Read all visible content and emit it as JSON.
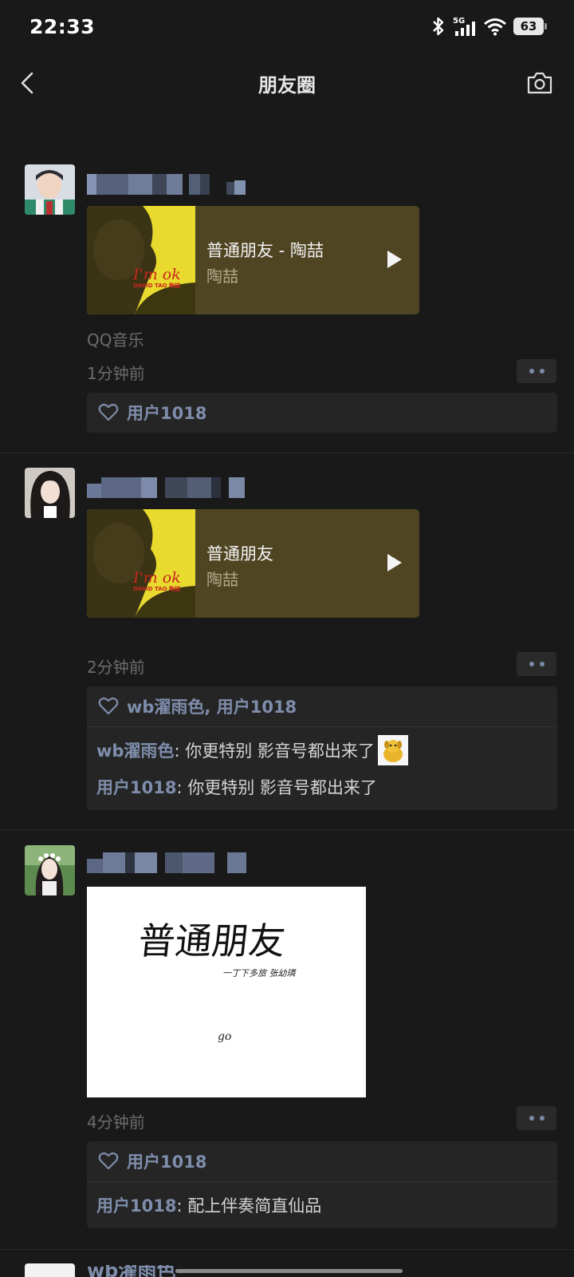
{
  "status": {
    "time": "22:33",
    "battery": "63",
    "network": "5G"
  },
  "nav": {
    "title": "朋友圈"
  },
  "colors": {
    "background": "#191919",
    "link": "#7e8dab",
    "music_card": "#504522"
  },
  "posts": [
    {
      "music": {
        "title": "普通朋友 - 陶喆",
        "artist": "陶喆",
        "cover_text": "I'm ok",
        "cover_sub": "DAVID TAO 陶喆"
      },
      "source": "QQ音乐",
      "time": "1分钟前",
      "likes": "用户1018",
      "comments": []
    },
    {
      "music": {
        "title": "普通朋友",
        "artist": "陶喆",
        "cover_text": "I'm ok",
        "cover_sub": "DAVID TAO 陶喆"
      },
      "time": "2分钟前",
      "likes": "wb濯雨色, 用户1018",
      "comments": [
        {
          "name": "wb濯雨色",
          "text": ": 你更特别 影音号都出来了"
        },
        {
          "name": "用户1018",
          "text": ": 你更特别 影音号都出来了"
        }
      ]
    },
    {
      "image": {
        "title": "普通朋友",
        "subtitle": "一丁下多旅 张幼璘",
        "sign": "go"
      },
      "time": "4分钟前",
      "likes": "用户1018",
      "comments": [
        {
          "name": "用户1018",
          "text": ": 配上伴奏简直仙品"
        }
      ]
    },
    {
      "nick": "wb濯雨色"
    }
  ]
}
